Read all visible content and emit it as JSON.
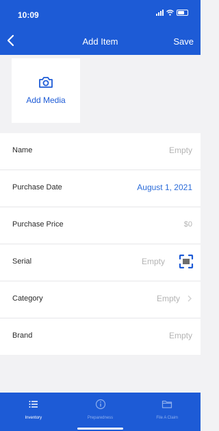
{
  "status_bar": {
    "time": "10:09"
  },
  "header": {
    "title": "Add Item",
    "save_label": "Save"
  },
  "media": {
    "label": "Add Media"
  },
  "fields": [
    {
      "label": "Name",
      "value": "Empty"
    },
    {
      "label": "Purchase Date",
      "value": "August 1, 2021"
    },
    {
      "label": "Purchase Price",
      "value": "$0"
    },
    {
      "label": "Serial",
      "value": "Empty"
    },
    {
      "label": "Category",
      "value": "Empty"
    },
    {
      "label": "Brand",
      "value": "Empty"
    }
  ],
  "tabbar": [
    {
      "label": "Inventory",
      "icon": "list-icon"
    },
    {
      "label": "Preparedness",
      "icon": "info-icon"
    },
    {
      "label": "File A Claim",
      "icon": "folder-icon"
    }
  ],
  "colors": {
    "primary": "#1d5bd6",
    "accent_text": "#2a6bd9",
    "muted_text": "#b3b3b3"
  }
}
